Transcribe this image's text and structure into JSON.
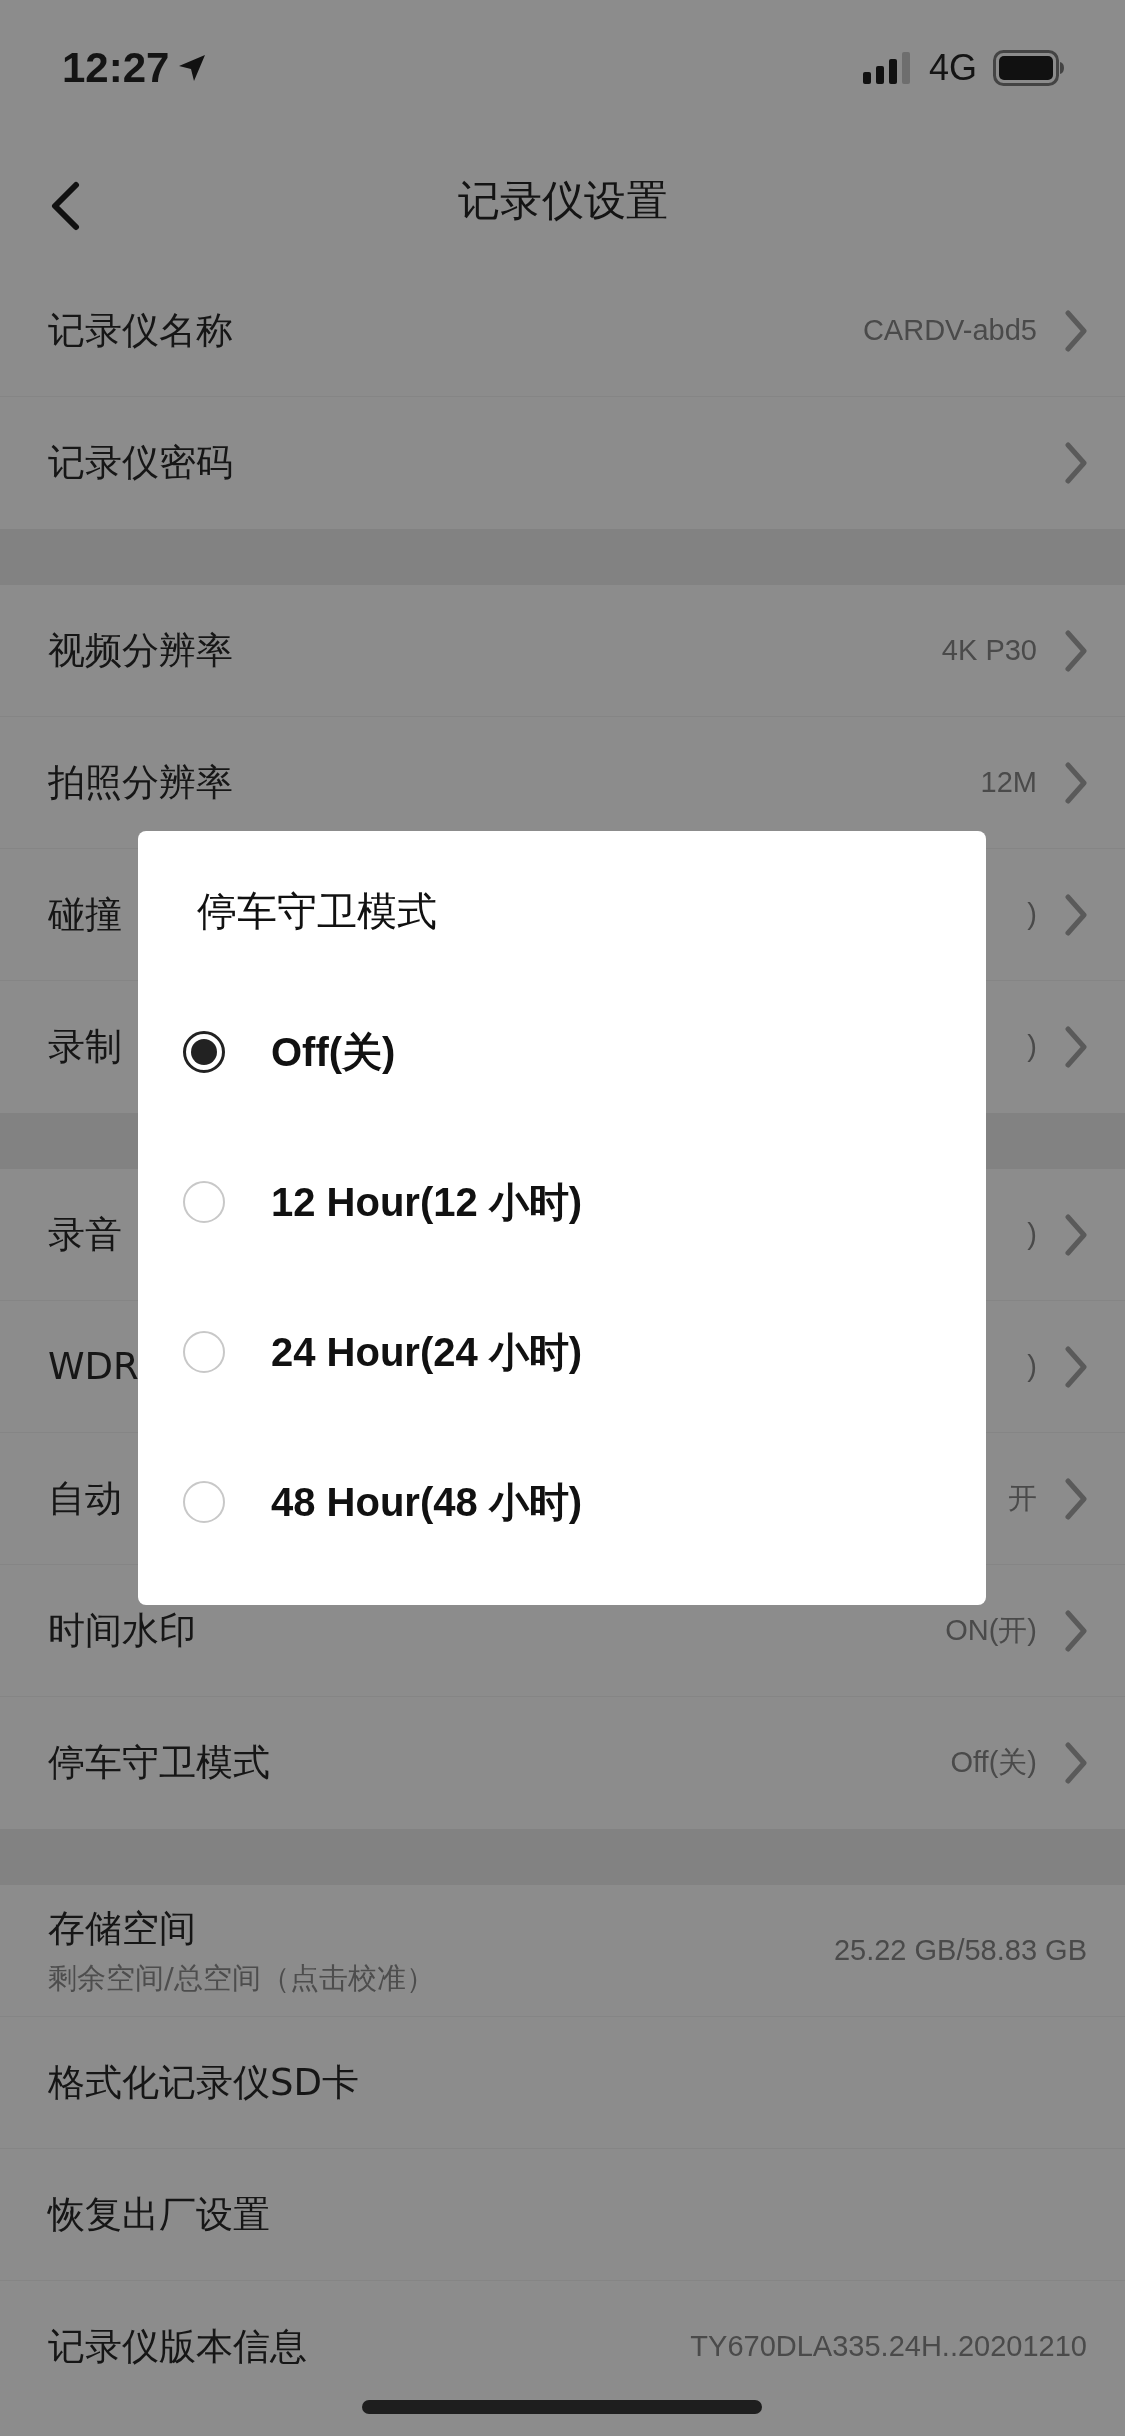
{
  "status_bar": {
    "time": "12:27",
    "network": "4G"
  },
  "nav": {
    "title": "记录仪设置"
  },
  "sections": [
    {
      "rows": [
        {
          "label": "记录仪名称",
          "value": "CARDV-abd5",
          "chevron": true
        },
        {
          "label": "记录仪密码",
          "chevron": true
        }
      ]
    },
    {
      "rows": [
        {
          "label": "视频分辨率",
          "value": "4K P30",
          "chevron": true
        },
        {
          "label": "拍照分辨率",
          "value": "12M",
          "chevron": true
        },
        {
          "label": "碰撞",
          "value": ")",
          "chevron": true
        },
        {
          "label": "录制",
          "value": ")",
          "chevron": true
        }
      ]
    },
    {
      "rows": [
        {
          "label": "录音",
          "value": ")",
          "chevron": true
        },
        {
          "label": "WDR",
          "value": ")",
          "chevron": true
        },
        {
          "label": "自动",
          "value": "开",
          "chevron": true
        },
        {
          "label": "时间水印",
          "value": "ON(开)",
          "chevron": true
        },
        {
          "label": "停车守卫模式",
          "value": "Off(关)",
          "chevron": true
        }
      ]
    },
    {
      "rows": [
        {
          "label": "存储空间",
          "sublabel": "剩余空间/总空间（点击校准）",
          "value": "25.22 GB/58.83 GB",
          "chevron": false
        },
        {
          "label": "格式化记录仪SD卡",
          "chevron": false
        },
        {
          "label": "恢复出厂设置",
          "chevron": false
        },
        {
          "label": "记录仪版本信息",
          "value": "TY670DLA335.24H..20201210",
          "chevron": false
        }
      ]
    }
  ],
  "dialog": {
    "title": "停车守卫模式",
    "options": [
      {
        "label": "Off(关)",
        "selected": true
      },
      {
        "label": "12 Hour(12 小时)",
        "selected": false
      },
      {
        "label": "24 Hour(24 小时)",
        "selected": false
      },
      {
        "label": "48 Hour(48 小时)",
        "selected": false
      }
    ]
  }
}
